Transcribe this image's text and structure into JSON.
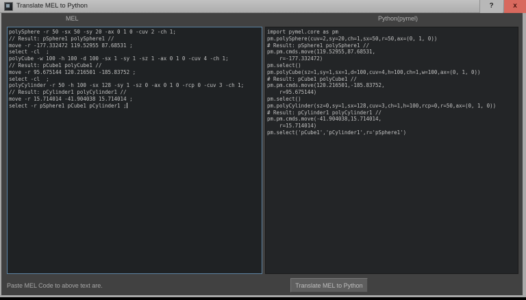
{
  "window": {
    "title": "Translate MEL to Python",
    "help_label": "?",
    "close_label": "x"
  },
  "header": {
    "left_label": "MEL",
    "right_label": "Python(pymel)"
  },
  "mel_pane": {
    "lines": [
      "polySphere -r 50 -sx 50 -sy 20 -ax 0 1 0 -cuv 2 -ch 1;",
      "// Result: pSphere1 polySphere1 //",
      "move -r -177.332472 119.52955 87.68531 ;",
      "select -cl  ;",
      "polyCube -w 100 -h 100 -d 100 -sx 1 -sy 1 -sz 1 -ax 0 1 0 -cuv 4 -ch 1;",
      "// Result: pCube1 polyCube1 //",
      "move -r 95.675144 120.216501 -185.83752 ;",
      "select -cl  ;",
      "polyCylinder -r 50 -h 100 -sx 128 -sy 1 -sz 0 -ax 0 1 0 -rcp 0 -cuv 3 -ch 1;",
      "// Result: pCylinder1 polyCylinder1 //",
      "move -r 15.714014 -41.904038 15.714014 ;",
      "select -r pSphere1 pCube1 pCylinder1 ;"
    ]
  },
  "python_pane": {
    "lines": [
      "import pymel.core as pm",
      "pm.polySphere(cuv=2,sy=20,ch=1,sx=50,r=50,ax=(0, 1, 0))",
      "# Result: pSphere1 polySphere1 //",
      "pm.pm.cmds.move(119.52955,87.68531,",
      "    r=-177.332472)",
      "pm.select()",
      "pm.polyCube(sz=1,sy=1,sx=1,d=100,cuv=4,h=100,ch=1,w=100,ax=(0, 1, 0))",
      "# Result: pCube1 polyCube1 //",
      "pm.pm.cmds.move(120.216501,-185.83752,",
      "    r=95.675144)",
      "pm.select()",
      "pm.polyCylinder(sz=0,sy=1,sx=128,cuv=3,ch=1,h=100,rcp=0,r=50,ax=(0, 1, 0))",
      "# Result: pCylinder1 polyCylinder1 //",
      "pm.pm.cmds.move(-41.904038,15.714014,",
      "    r=15.714014)",
      "pm.select('pCube1','pCylinder1',r='pSphere1')"
    ]
  },
  "footer": {
    "hint": "Paste MEL Code to above text are.",
    "translate_button_label": "Translate MEL to Python"
  },
  "colors": {
    "titlebar": "#b5b5b5",
    "dialog_bg": "#414141",
    "pane_bg": "#202224",
    "code_text": "#c3c3c3",
    "focus_border": "#5c83a3",
    "close_button": "#d8695e"
  }
}
